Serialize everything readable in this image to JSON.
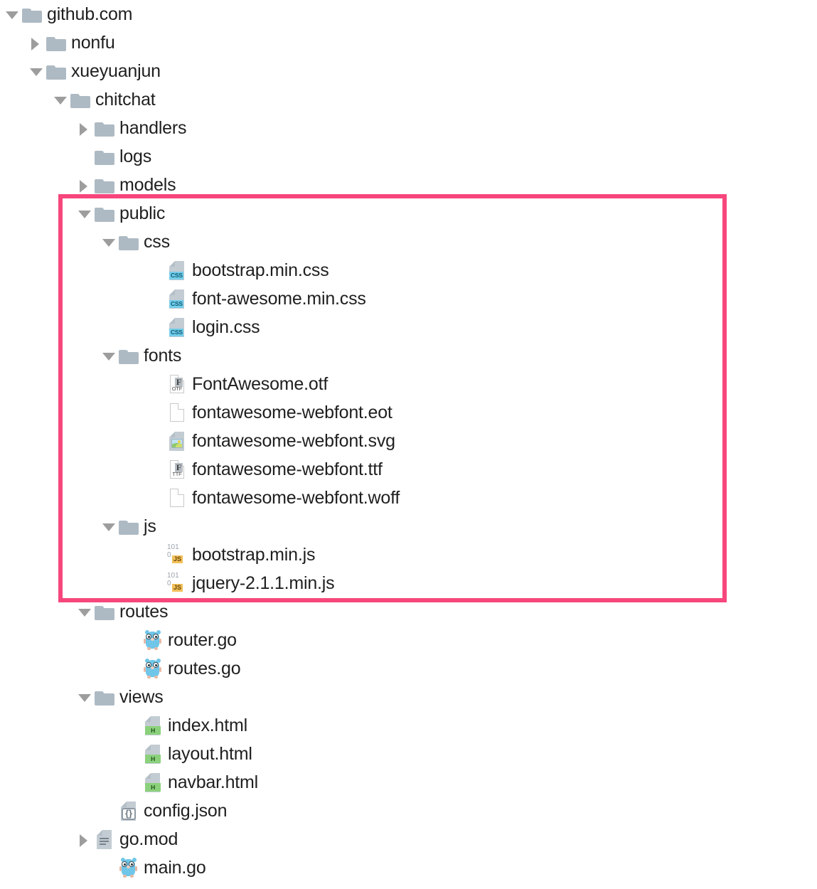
{
  "view": {
    "kind": "file-tree",
    "background_color": "#ffffff",
    "text_color": "#1f1f1f",
    "folder_color": "#aebac3",
    "twisty_color": "#9d9d9d",
    "highlight_color": "#f7467c"
  },
  "highlight": {
    "label": "public-folder-highlight",
    "covers_from": "public",
    "covers_to": "jquery-2.1.1.min.js"
  },
  "tree": [
    {
      "name": "github.com",
      "icon": "folder",
      "twisty": "open",
      "depth": 0
    },
    {
      "name": "nonfu",
      "icon": "folder",
      "twisty": "closed",
      "depth": 1
    },
    {
      "name": "xueyuanjun",
      "icon": "folder",
      "twisty": "open",
      "depth": 1
    },
    {
      "name": "chitchat",
      "icon": "folder",
      "twisty": "open",
      "depth": 2
    },
    {
      "name": "handlers",
      "icon": "folder",
      "twisty": "closed",
      "depth": 3
    },
    {
      "name": "logs",
      "icon": "folder",
      "twisty": "none",
      "depth": 3
    },
    {
      "name": "models",
      "icon": "folder",
      "twisty": "closed",
      "depth": 3
    },
    {
      "name": "public",
      "icon": "folder",
      "twisty": "open",
      "depth": 3
    },
    {
      "name": "css",
      "icon": "folder",
      "twisty": "open",
      "depth": 4
    },
    {
      "name": "bootstrap.min.css",
      "icon": "css-file",
      "twisty": "none",
      "depth": 6
    },
    {
      "name": "font-awesome.min.css",
      "icon": "css-file",
      "twisty": "none",
      "depth": 6
    },
    {
      "name": "login.css",
      "icon": "css-file",
      "twisty": "none",
      "depth": 6
    },
    {
      "name": "fonts",
      "icon": "folder",
      "twisty": "open",
      "depth": 4
    },
    {
      "name": "FontAwesome.otf",
      "icon": "otf-file",
      "twisty": "none",
      "depth": 6
    },
    {
      "name": "fontawesome-webfont.eot",
      "icon": "blank-file",
      "twisty": "none",
      "depth": 6
    },
    {
      "name": "fontawesome-webfont.svg",
      "icon": "image-file",
      "twisty": "none",
      "depth": 6
    },
    {
      "name": "fontawesome-webfont.ttf",
      "icon": "ttf-file",
      "twisty": "none",
      "depth": 6
    },
    {
      "name": "fontawesome-webfont.woff",
      "icon": "blank-file",
      "twisty": "none",
      "depth": 6
    },
    {
      "name": "js",
      "icon": "folder",
      "twisty": "open",
      "depth": 4
    },
    {
      "name": "bootstrap.min.js",
      "icon": "js-file",
      "twisty": "none",
      "depth": 6
    },
    {
      "name": "jquery-2.1.1.min.js",
      "icon": "js-file",
      "twisty": "none",
      "depth": 6
    },
    {
      "name": "routes",
      "icon": "folder",
      "twisty": "open",
      "depth": 3
    },
    {
      "name": "router.go",
      "icon": "go-file",
      "twisty": "none",
      "depth": 5
    },
    {
      "name": "routes.go",
      "icon": "go-file",
      "twisty": "none",
      "depth": 5
    },
    {
      "name": "views",
      "icon": "folder",
      "twisty": "open",
      "depth": 3
    },
    {
      "name": "index.html",
      "icon": "html-file",
      "twisty": "none",
      "depth": 5
    },
    {
      "name": "layout.html",
      "icon": "html-file",
      "twisty": "none",
      "depth": 5
    },
    {
      "name": "navbar.html",
      "icon": "html-file",
      "twisty": "none",
      "depth": 5
    },
    {
      "name": "config.json",
      "icon": "json-file",
      "twisty": "none",
      "depth": 4
    },
    {
      "name": "go.mod",
      "icon": "lines-file",
      "twisty": "closed",
      "depth": 3
    },
    {
      "name": "main.go",
      "icon": "go-file",
      "twisty": "none",
      "depth": 4
    }
  ],
  "icon_badges": {
    "css": "CSS",
    "html": "H",
    "js_bits_top": "101",
    "js_bits_bottom": "0",
    "js_chip": "JS",
    "otf": "OTF",
    "ttf": "TTF",
    "font_glyph": "F",
    "json_braces": "{}"
  }
}
